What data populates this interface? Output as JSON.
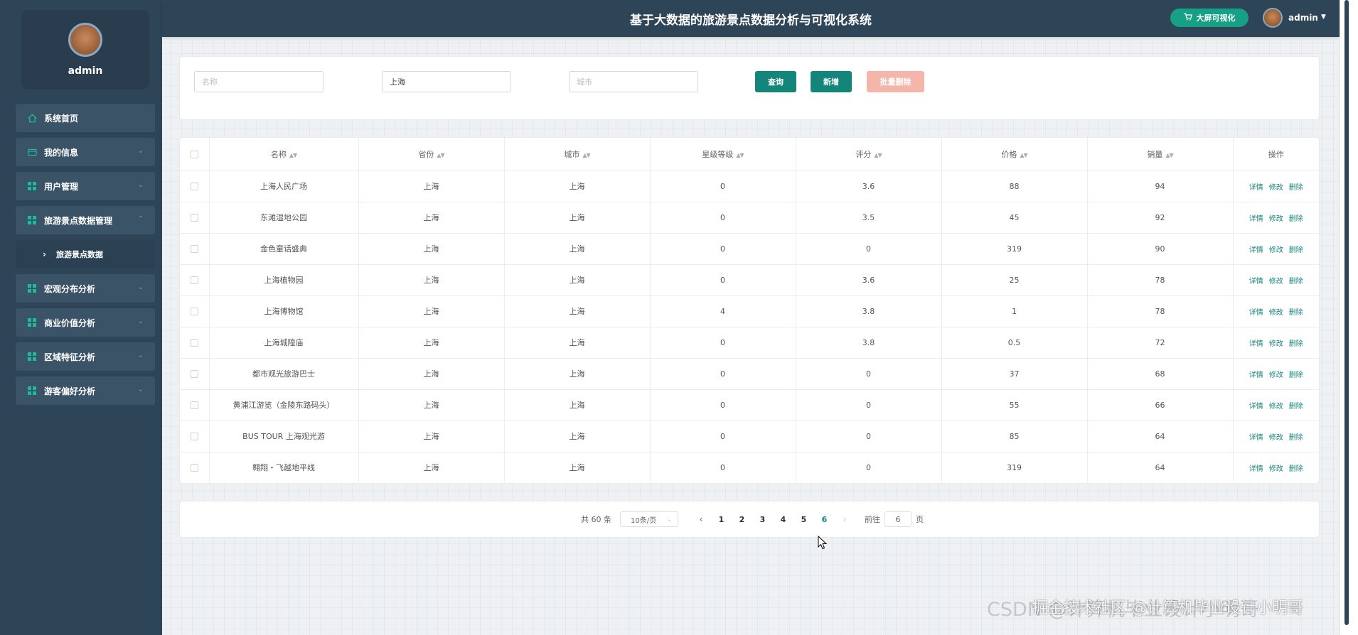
{
  "app": {
    "title": "基于大数据的旅游景点数据分析与可视化系统"
  },
  "header": {
    "bigscreen_label": "大屏可视化",
    "user": "admin"
  },
  "sidebar": {
    "username": "admin",
    "items": [
      {
        "label": "系统首页",
        "icon": "home-icon"
      },
      {
        "label": "我的信息",
        "icon": "card-icon"
      },
      {
        "label": "用户管理",
        "icon": "grid-icon"
      },
      {
        "label": "旅游景点数据管理",
        "icon": "grid-icon"
      },
      {
        "label": "旅游景点数据",
        "icon": "chevron-right-icon"
      },
      {
        "label": "宏观分布分析",
        "icon": "grid-icon"
      },
      {
        "label": "商业价值分析",
        "icon": "grid-icon"
      },
      {
        "label": "区域特征分析",
        "icon": "grid-icon"
      },
      {
        "label": "游客偏好分析",
        "icon": "grid-icon"
      }
    ]
  },
  "search": {
    "name_placeholder": "名称",
    "province_value": "上海",
    "city_placeholder": "城市",
    "query_label": "查询",
    "add_label": "新增",
    "batch_delete_label": "批量删除"
  },
  "table": {
    "headers": [
      "名称",
      "省份",
      "城市",
      "星级等级",
      "评分",
      "价格",
      "销量",
      "操作"
    ],
    "actions": [
      "详情",
      "修改",
      "删除"
    ],
    "rows": [
      [
        "上海人民广场",
        "上海",
        "上海",
        "0",
        "3.6",
        "88",
        "94"
      ],
      [
        "东滩湿地公园",
        "上海",
        "上海",
        "0",
        "3.5",
        "45",
        "92"
      ],
      [
        "金色童话盛典",
        "上海",
        "上海",
        "0",
        "0",
        "319",
        "90"
      ],
      [
        "上海植物园",
        "上海",
        "上海",
        "0",
        "3.6",
        "25",
        "78"
      ],
      [
        "上海博物馆",
        "上海",
        "上海",
        "4",
        "3.8",
        "1",
        "78"
      ],
      [
        "上海城隍庙",
        "上海",
        "上海",
        "0",
        "3.8",
        "0.5",
        "72"
      ],
      [
        "都市观光旅游巴士",
        "上海",
        "上海",
        "0",
        "0",
        "37",
        "68"
      ],
      [
        "黄浦江游览（金陵东路码头）",
        "上海",
        "上海",
        "0",
        "0",
        "55",
        "66"
      ],
      [
        "BUS TOUR 上海观光游",
        "上海",
        "上海",
        "0",
        "0",
        "85",
        "64"
      ],
      [
        "翱翔・飞越地平线",
        "上海",
        "上海",
        "0",
        "0",
        "319",
        "64"
      ]
    ]
  },
  "pagination": {
    "total": "共 60 条",
    "page_size": "10条/页",
    "pages": [
      "1",
      "2",
      "3",
      "4",
      "5",
      "6"
    ],
    "current": "6",
    "jump_prefix": "前往",
    "jump_value": "6",
    "jump_suffix": "页"
  },
  "watermark": {
    "text1": "CSDN @计算机毕业设计小明哥",
    "text2": "掘金技术社区 @计算机毕业设计小明哥"
  },
  "colors": {
    "sidebar_bg": "#2e4457",
    "accent": "#14857a",
    "danger_light": "#f4b5aa"
  }
}
